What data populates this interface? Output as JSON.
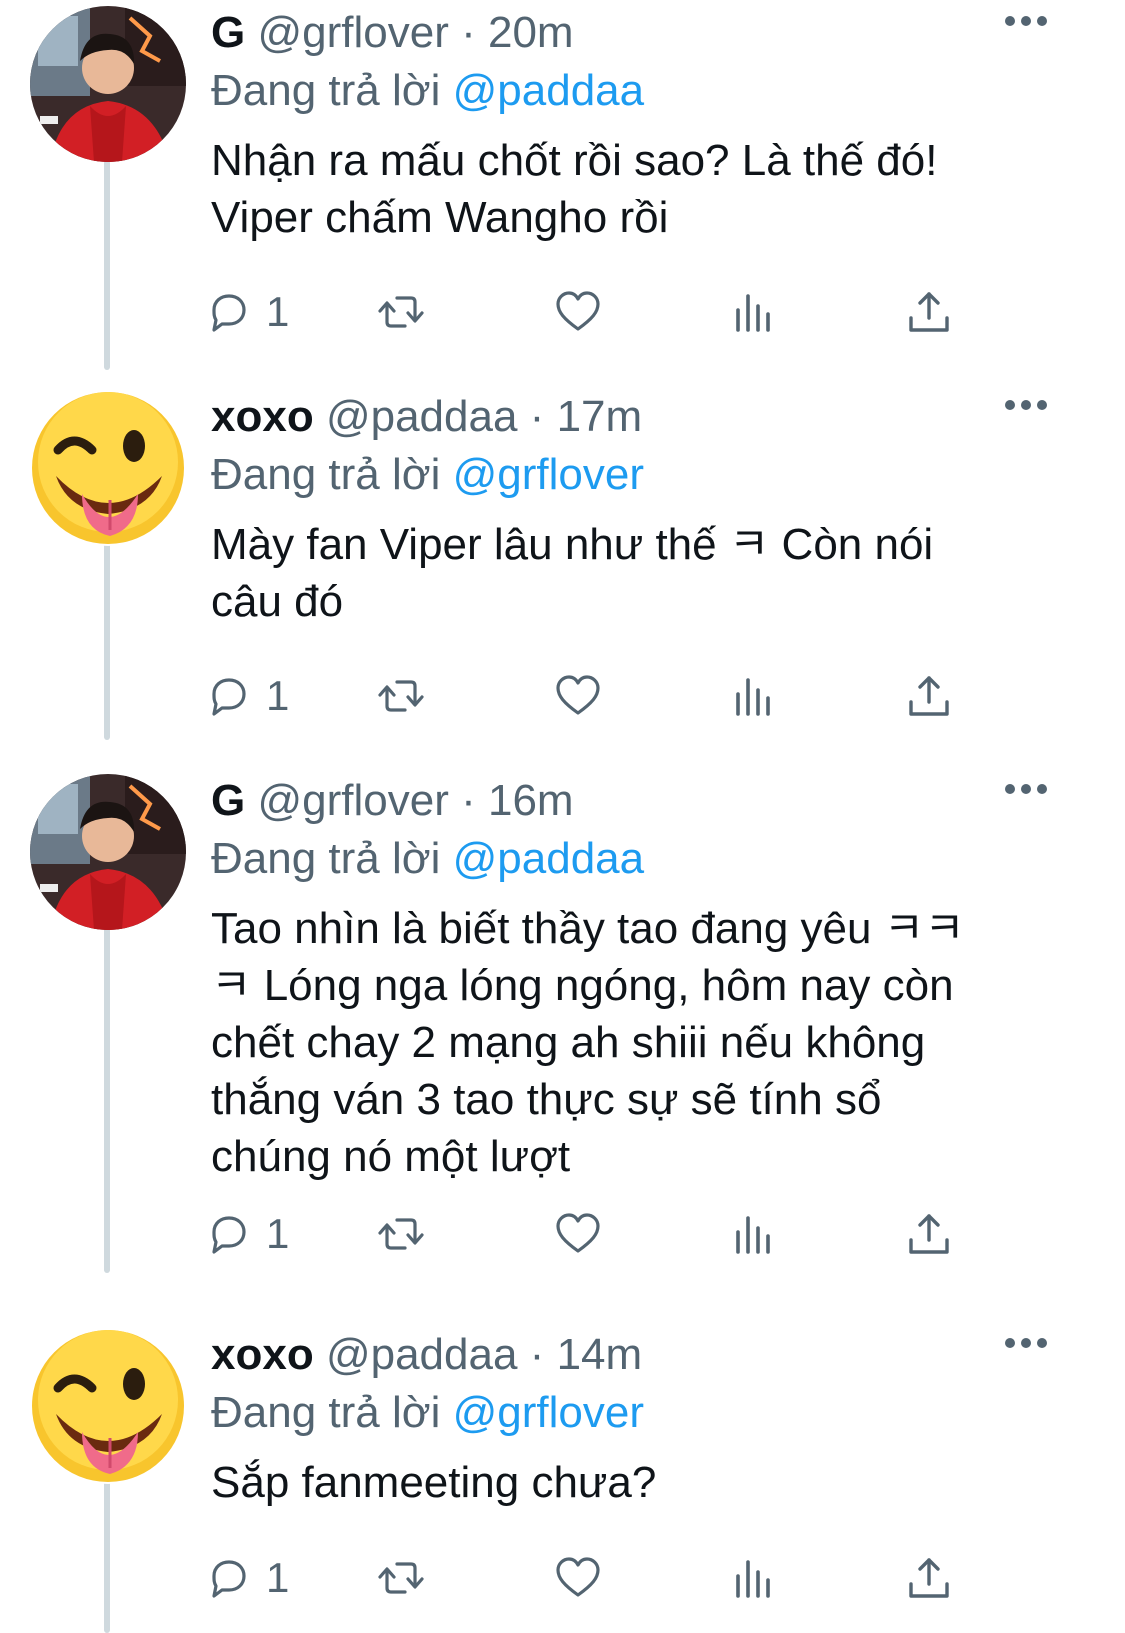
{
  "tweets": [
    {
      "name": "G",
      "handle": "@grflover",
      "dot": "·",
      "time": "20m",
      "replying_label": "Đang trả lời",
      "replying_to": "@paddaa",
      "lines": [
        "Nhận ra mấu chốt rồi sao? Là thế đó!",
        "Viper chấm Wangho rồi"
      ],
      "reply_count": "1",
      "avatar_icon": "user-photo-avatar"
    },
    {
      "name": "xoxo",
      "handle": "@paddaa",
      "dot": "·",
      "time": "17m",
      "replying_label": "Đang trả lời",
      "replying_to": "@grflover",
      "lines": [
        "Mày fan Viper lâu như thế ㅋ Còn nói",
        "câu đó"
      ],
      "reply_count": "1",
      "avatar_icon": "winking-tongue-emoji-avatar"
    },
    {
      "name": "G",
      "handle": "@grflover",
      "dot": "·",
      "time": "16m",
      "replying_label": "Đang trả lời",
      "replying_to": "@paddaa",
      "lines": [
        "Tao nhìn là biết thầy tao đang yêu ㅋㅋ",
        "ㅋ Lóng nga lóng ngóng, hôm nay còn",
        "chết chay 2 mạng ah shiii nếu không",
        "thắng ván 3 tao thực sự sẽ tính sổ",
        "chúng nó một lượt"
      ],
      "reply_count": "1",
      "avatar_icon": "user-photo-avatar"
    },
    {
      "name": "xoxo",
      "handle": "@paddaa",
      "dot": "·",
      "time": "14m",
      "replying_label": "Đang trả lời",
      "replying_to": "@grflover",
      "lines": [
        "Sắp fanmeeting chưa?"
      ],
      "reply_count": "1",
      "avatar_icon": "winking-tongue-emoji-avatar"
    }
  ],
  "colors": {
    "text": "#0f1419",
    "secondary": "#536471",
    "link": "#1d9bf0",
    "thread_line": "#cfd9de"
  }
}
